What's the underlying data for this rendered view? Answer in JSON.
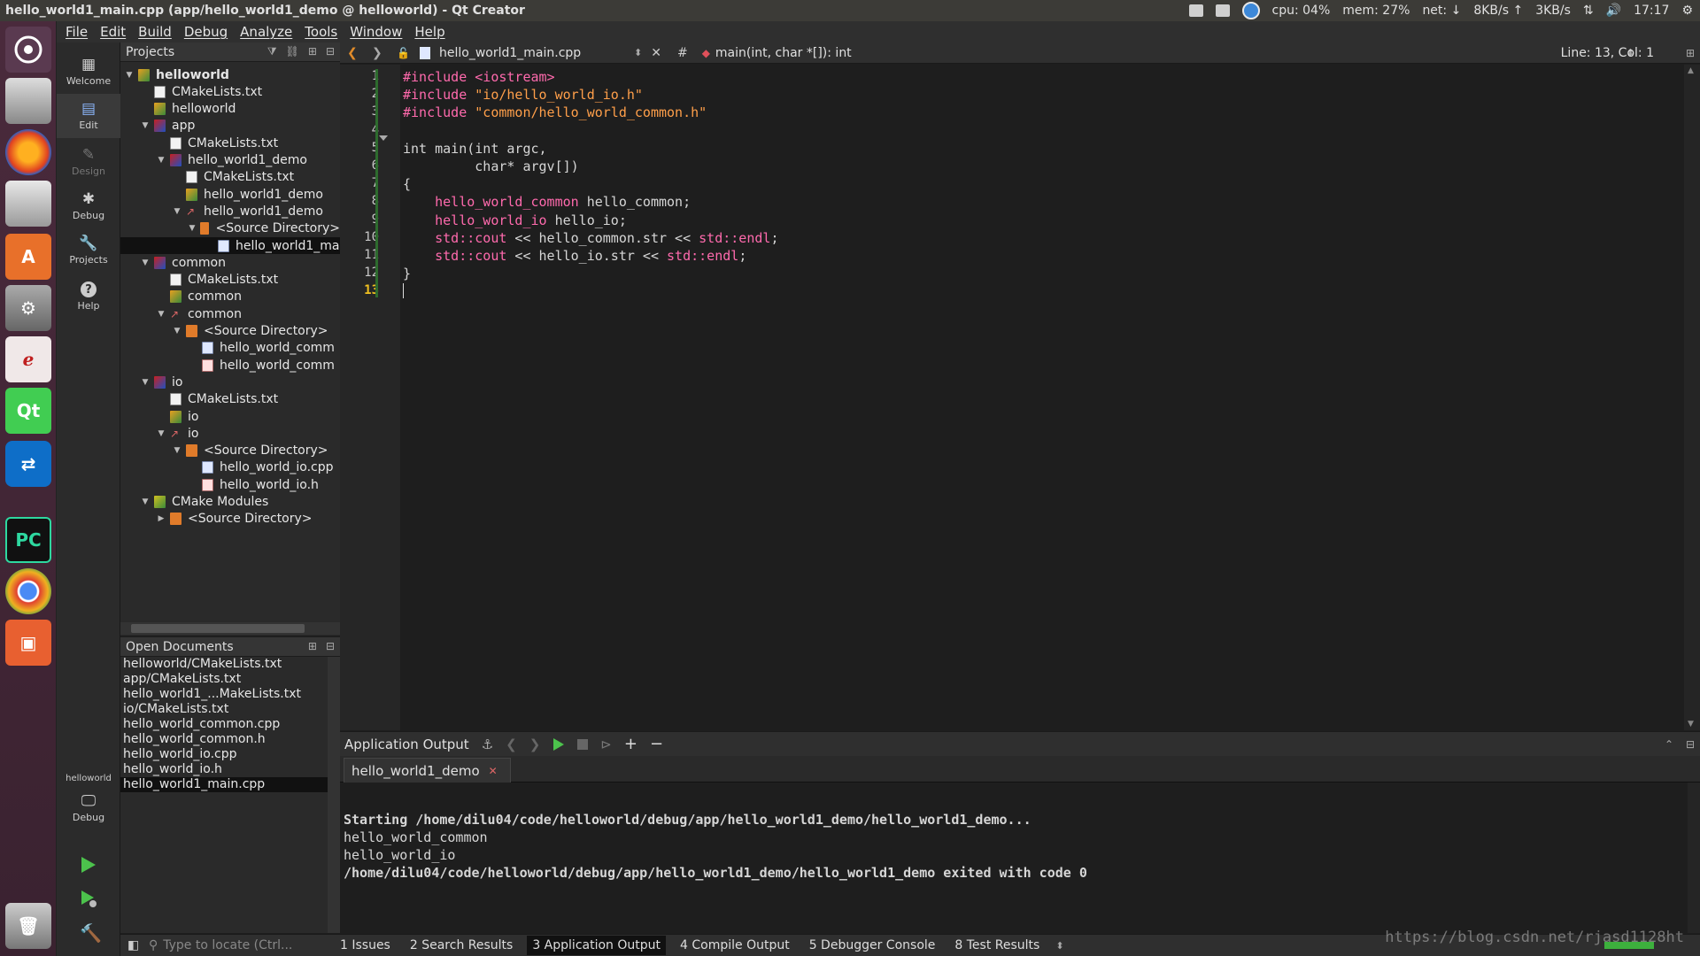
{
  "window": {
    "title": "hello_world1_main.cpp (app/hello_world1_demo @ helloworld) - Qt Creator"
  },
  "tray": {
    "cpu": "cpu: 04%",
    "mem": "mem: 27%",
    "net": "net: ↓",
    "down": "8KB/s ↑",
    "up": "3KB/s",
    "clock": "17:17"
  },
  "menu": [
    "File",
    "Edit",
    "Build",
    "Debug",
    "Analyze",
    "Tools",
    "Window",
    "Help"
  ],
  "modes": {
    "welcome": "Welcome",
    "edit": "Edit",
    "design": "Design",
    "debug": "Debug",
    "projects": "Projects",
    "help": "Help",
    "kit_label": "helloworld",
    "kit_mode": "Debug"
  },
  "projects_panel": {
    "title": "Projects",
    "tree": [
      {
        "label": "helloworld",
        "icon": "project-icon",
        "depth": 0,
        "expanded": true,
        "bold": true
      },
      {
        "label": "CMakeLists.txt",
        "icon": "text-file-icon",
        "depth": 1
      },
      {
        "label": "helloworld",
        "icon": "project-icon",
        "depth": 1
      },
      {
        "label": "app",
        "icon": "cmake-folder-icon",
        "depth": 1,
        "expanded": true
      },
      {
        "label": "CMakeLists.txt",
        "icon": "text-file-icon",
        "depth": 2
      },
      {
        "label": "hello_world1_demo",
        "icon": "cmake-folder-icon",
        "depth": 2,
        "expanded": true
      },
      {
        "label": "CMakeLists.txt",
        "icon": "text-file-icon",
        "depth": 3
      },
      {
        "label": "hello_world1_demo",
        "icon": "project-icon",
        "depth": 3
      },
      {
        "label": "hello_world1_demo",
        "icon": "target-icon",
        "depth": 3,
        "expanded": true
      },
      {
        "label": "<Source Directory>",
        "icon": "folder-icon",
        "depth": 4,
        "expanded": true
      },
      {
        "label": "hello_world1_ma",
        "icon": "cpp-file-icon",
        "depth": 5,
        "selected": true
      },
      {
        "label": "common",
        "icon": "cmake-folder-icon",
        "depth": 1,
        "expanded": true
      },
      {
        "label": "CMakeLists.txt",
        "icon": "text-file-icon",
        "depth": 2
      },
      {
        "label": "common",
        "icon": "project-icon",
        "depth": 2
      },
      {
        "label": "common",
        "icon": "target-icon",
        "depth": 2,
        "expanded": true
      },
      {
        "label": "<Source Directory>",
        "icon": "folder-icon",
        "depth": 3,
        "expanded": true
      },
      {
        "label": "hello_world_comm",
        "icon": "cpp-file-icon",
        "depth": 4
      },
      {
        "label": "hello_world_comm",
        "icon": "header-file-icon",
        "depth": 4
      },
      {
        "label": "io",
        "icon": "cmake-folder-icon",
        "depth": 1,
        "expanded": true
      },
      {
        "label": "CMakeLists.txt",
        "icon": "text-file-icon",
        "depth": 2
      },
      {
        "label": "io",
        "icon": "project-icon",
        "depth": 2
      },
      {
        "label": "io",
        "icon": "target-icon",
        "depth": 2,
        "expanded": true
      },
      {
        "label": "<Source Directory>",
        "icon": "folder-icon",
        "depth": 3,
        "expanded": true
      },
      {
        "label": "hello_world_io.cpp",
        "icon": "cpp-file-icon",
        "depth": 4
      },
      {
        "label": "hello_world_io.h",
        "icon": "header-file-icon",
        "depth": 4
      },
      {
        "label": "CMake Modules",
        "icon": "modules-icon",
        "depth": 1,
        "expanded": true
      },
      {
        "label": "<Source Directory>",
        "icon": "folder-icon",
        "depth": 2,
        "expanded": false
      }
    ]
  },
  "open_documents": {
    "title": "Open Documents",
    "items": [
      "helloworld/CMakeLists.txt",
      "app/CMakeLists.txt",
      "hello_world1_...MakeLists.txt",
      "io/CMakeLists.txt",
      "hello_world_common.cpp",
      "hello_world_common.h",
      "hello_world_io.cpp",
      "hello_world_io.h",
      "hello_world1_main.cpp"
    ],
    "selected_index": 8
  },
  "editor": {
    "file": "hello_world1_main.cpp",
    "hash": "#",
    "symbol": "main(int, char *[]): int",
    "position": "Line: 13, Col: 1",
    "current_line": 13,
    "lines": [
      [
        {
          "t": "#include <iostream>",
          "c": "pp"
        }
      ],
      [
        {
          "t": "#include ",
          "c": "pp"
        },
        {
          "t": "\"io/hello_world_io.h\"",
          "c": "str"
        }
      ],
      [
        {
          "t": "#include ",
          "c": "pp"
        },
        {
          "t": "\"common/hello_world_common.h\"",
          "c": "str"
        }
      ],
      [],
      [
        {
          "t": "int main(int argc,",
          "c": ""
        }
      ],
      [
        {
          "t": "         char* argv[])",
          "c": ""
        }
      ],
      [
        {
          "t": "{",
          "c": ""
        }
      ],
      [
        {
          "t": "    ",
          "c": ""
        },
        {
          "t": "hello_world_common",
          "c": "ty"
        },
        {
          "t": " hello_common;",
          "c": ""
        }
      ],
      [
        {
          "t": "    ",
          "c": ""
        },
        {
          "t": "hello_world_io",
          "c": "ty"
        },
        {
          "t": " hello_io;",
          "c": ""
        }
      ],
      [
        {
          "t": "    ",
          "c": ""
        },
        {
          "t": "std::cout",
          "c": "ty"
        },
        {
          "t": " << hello_common.str << ",
          "c": ""
        },
        {
          "t": "std::endl",
          "c": "ty"
        },
        {
          "t": ";",
          "c": ""
        }
      ],
      [
        {
          "t": "    ",
          "c": ""
        },
        {
          "t": "std::cout",
          "c": "ty"
        },
        {
          "t": " << hello_io.str << ",
          "c": ""
        },
        {
          "t": "std::endl",
          "c": "ty"
        },
        {
          "t": ";",
          "c": ""
        }
      ],
      [
        {
          "t": "}",
          "c": ""
        }
      ],
      []
    ]
  },
  "output_pane": {
    "title": "Application Output",
    "tab": "hello_world1_demo",
    "lines": [
      {
        "text": "Starting /home/dilu04/code/helloworld/debug/app/hello_world1_demo/hello_world1_demo...",
        "bold": true
      },
      {
        "text": "hello_world_common",
        "bold": false
      },
      {
        "text": "hello_world_io",
        "bold": false
      },
      {
        "text": "/home/dilu04/code/helloworld/debug/app/hello_world1_demo/hello_world1_demo exited with code 0",
        "bold": true
      }
    ]
  },
  "statusbar": {
    "locate_placeholder": "Type to locate (Ctrl...",
    "tabs": [
      "1  Issues",
      "2  Search Results",
      "3  Application Output",
      "4  Compile Output",
      "5  Debugger Console",
      "8  Test Results"
    ],
    "active_tab": 2
  },
  "watermark": "https://blog.csdn.net/rjasd1128ht"
}
